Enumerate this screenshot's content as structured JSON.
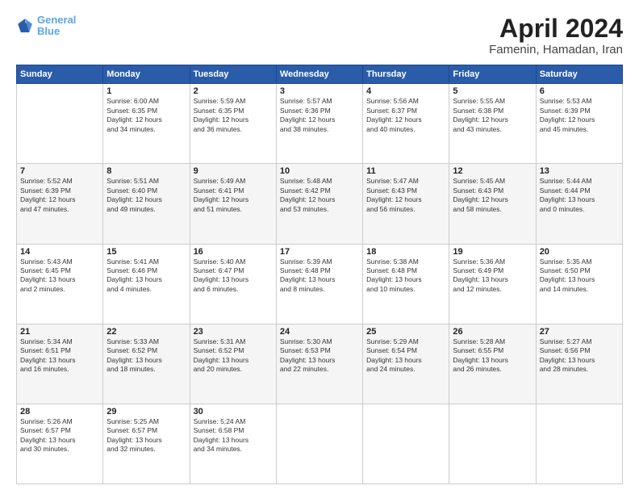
{
  "logo": {
    "line1": "General",
    "line2": "Blue"
  },
  "title": "April 2024",
  "subtitle": "Famenin, Hamadan, Iran",
  "weekdays": [
    "Sunday",
    "Monday",
    "Tuesday",
    "Wednesday",
    "Thursday",
    "Friday",
    "Saturday"
  ],
  "weeks": [
    [
      {
        "day": "",
        "info": ""
      },
      {
        "day": "1",
        "info": "Sunrise: 6:00 AM\nSunset: 6:35 PM\nDaylight: 12 hours\nand 34 minutes."
      },
      {
        "day": "2",
        "info": "Sunrise: 5:59 AM\nSunset: 6:35 PM\nDaylight: 12 hours\nand 36 minutes."
      },
      {
        "day": "3",
        "info": "Sunrise: 5:57 AM\nSunset: 6:36 PM\nDaylight: 12 hours\nand 38 minutes."
      },
      {
        "day": "4",
        "info": "Sunrise: 5:56 AM\nSunset: 6:37 PM\nDaylight: 12 hours\nand 40 minutes."
      },
      {
        "day": "5",
        "info": "Sunrise: 5:55 AM\nSunset: 6:38 PM\nDaylight: 12 hours\nand 43 minutes."
      },
      {
        "day": "6",
        "info": "Sunrise: 5:53 AM\nSunset: 6:39 PM\nDaylight: 12 hours\nand 45 minutes."
      }
    ],
    [
      {
        "day": "7",
        "info": "Sunrise: 5:52 AM\nSunset: 6:39 PM\nDaylight: 12 hours\nand 47 minutes."
      },
      {
        "day": "8",
        "info": "Sunrise: 5:51 AM\nSunset: 6:40 PM\nDaylight: 12 hours\nand 49 minutes."
      },
      {
        "day": "9",
        "info": "Sunrise: 5:49 AM\nSunset: 6:41 PM\nDaylight: 12 hours\nand 51 minutes."
      },
      {
        "day": "10",
        "info": "Sunrise: 5:48 AM\nSunset: 6:42 PM\nDaylight: 12 hours\nand 53 minutes."
      },
      {
        "day": "11",
        "info": "Sunrise: 5:47 AM\nSunset: 6:43 PM\nDaylight: 12 hours\nand 56 minutes."
      },
      {
        "day": "12",
        "info": "Sunrise: 5:45 AM\nSunset: 6:43 PM\nDaylight: 12 hours\nand 58 minutes."
      },
      {
        "day": "13",
        "info": "Sunrise: 5:44 AM\nSunset: 6:44 PM\nDaylight: 13 hours\nand 0 minutes."
      }
    ],
    [
      {
        "day": "14",
        "info": "Sunrise: 5:43 AM\nSunset: 6:45 PM\nDaylight: 13 hours\nand 2 minutes."
      },
      {
        "day": "15",
        "info": "Sunrise: 5:41 AM\nSunset: 6:46 PM\nDaylight: 13 hours\nand 4 minutes."
      },
      {
        "day": "16",
        "info": "Sunrise: 5:40 AM\nSunset: 6:47 PM\nDaylight: 13 hours\nand 6 minutes."
      },
      {
        "day": "17",
        "info": "Sunrise: 5:39 AM\nSunset: 6:48 PM\nDaylight: 13 hours\nand 8 minutes."
      },
      {
        "day": "18",
        "info": "Sunrise: 5:38 AM\nSunset: 6:48 PM\nDaylight: 13 hours\nand 10 minutes."
      },
      {
        "day": "19",
        "info": "Sunrise: 5:36 AM\nSunset: 6:49 PM\nDaylight: 13 hours\nand 12 minutes."
      },
      {
        "day": "20",
        "info": "Sunrise: 5:35 AM\nSunset: 6:50 PM\nDaylight: 13 hours\nand 14 minutes."
      }
    ],
    [
      {
        "day": "21",
        "info": "Sunrise: 5:34 AM\nSunset: 6:51 PM\nDaylight: 13 hours\nand 16 minutes."
      },
      {
        "day": "22",
        "info": "Sunrise: 5:33 AM\nSunset: 6:52 PM\nDaylight: 13 hours\nand 18 minutes."
      },
      {
        "day": "23",
        "info": "Sunrise: 5:31 AM\nSunset: 6:52 PM\nDaylight: 13 hours\nand 20 minutes."
      },
      {
        "day": "24",
        "info": "Sunrise: 5:30 AM\nSunset: 6:53 PM\nDaylight: 13 hours\nand 22 minutes."
      },
      {
        "day": "25",
        "info": "Sunrise: 5:29 AM\nSunset: 6:54 PM\nDaylight: 13 hours\nand 24 minutes."
      },
      {
        "day": "26",
        "info": "Sunrise: 5:28 AM\nSunset: 6:55 PM\nDaylight: 13 hours\nand 26 minutes."
      },
      {
        "day": "27",
        "info": "Sunrise: 5:27 AM\nSunset: 6:56 PM\nDaylight: 13 hours\nand 28 minutes."
      }
    ],
    [
      {
        "day": "28",
        "info": "Sunrise: 5:26 AM\nSunset: 6:57 PM\nDaylight: 13 hours\nand 30 minutes."
      },
      {
        "day": "29",
        "info": "Sunrise: 5:25 AM\nSunset: 6:57 PM\nDaylight: 13 hours\nand 32 minutes."
      },
      {
        "day": "30",
        "info": "Sunrise: 5:24 AM\nSunset: 6:58 PM\nDaylight: 13 hours\nand 34 minutes."
      },
      {
        "day": "",
        "info": ""
      },
      {
        "day": "",
        "info": ""
      },
      {
        "day": "",
        "info": ""
      },
      {
        "day": "",
        "info": ""
      }
    ]
  ]
}
